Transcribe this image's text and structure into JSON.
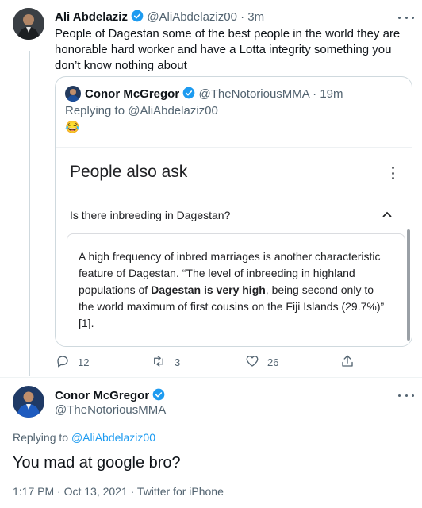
{
  "tweet1": {
    "author_name": "Ali Abdelaziz",
    "author_handle": "@AliAbdelaziz00",
    "time": "· 3m",
    "text": "People of Dagestan some of the best people in the world they are honorable hard worker and  have a Lotta integrity something you don’t know nothing about"
  },
  "quoted": {
    "author_name": "Conor McGregor",
    "author_handle": "@TheNotoriousMMA",
    "time": "· 19m",
    "replying_prefix": "Replying to ",
    "replying_handle": "@AliAbdelaziz00",
    "emoji": "😂",
    "google": {
      "heading": "People also ask",
      "question": "Is there inbreeding in Dagestan?",
      "answer_part1": "A high frequency of inbred marriages is another characteristic feature of Dagestan. “The level of inbreeding in highland populations of ",
      "answer_bold": "Dagestan is very high",
      "answer_part2": ", being second only to the world maximum of first cousins on the Fiji Islands (29.7%)” [1]."
    }
  },
  "actions": {
    "replies": "12",
    "retweets": "3",
    "likes": "26"
  },
  "tweet2": {
    "author_name": "Conor McGregor",
    "author_handle": "@TheNotoriousMMA",
    "replying_prefix": "Replying to ",
    "replying_handle": "@AliAbdelaziz00",
    "text": "You mad at google bro?",
    "meta": "1:17 PM · Oct 13, 2021 · Twitter for iPhone"
  },
  "colors": {
    "accent": "#1d9bf0",
    "text": "#0f1419",
    "muted": "#536471"
  }
}
